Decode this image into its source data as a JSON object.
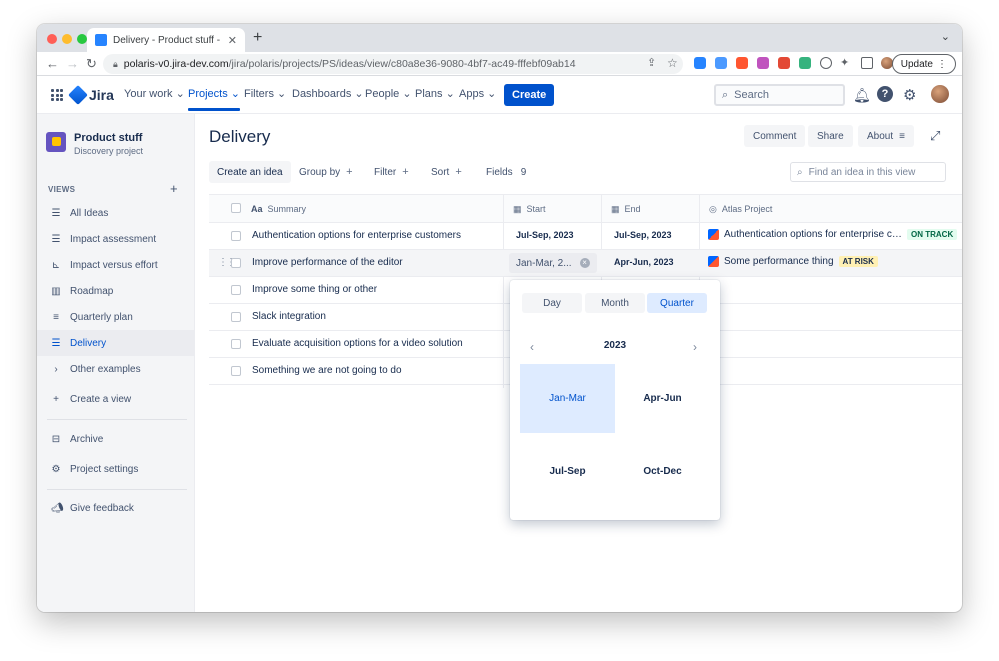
{
  "browser": {
    "tab_title": "Delivery - Product stuff - Jira Software",
    "url_host": "polaris-v0.jira-dev.com",
    "url_path": "/jira/polaris/projects/PS/ideas/view/c80a8e36-9080-4bf7-ac49-fffebf09ab14",
    "update_label": "Update"
  },
  "topnav": {
    "logo": "Jira",
    "items": [
      "Your work",
      "Projects",
      "Filters",
      "Dashboards",
      "People",
      "Plans",
      "Apps"
    ],
    "create_label": "Create",
    "search_placeholder": "Search"
  },
  "sidebar": {
    "project_name": "Product stuff",
    "project_type": "Discovery project",
    "views_header": "VIEWS",
    "views": [
      {
        "label": "All Ideas",
        "icon": "list-icon"
      },
      {
        "label": "Impact assessment",
        "icon": "list-icon"
      },
      {
        "label": "Impact versus effort",
        "icon": "matrix-icon"
      },
      {
        "label": "Roadmap",
        "icon": "board-icon"
      },
      {
        "label": "Quarterly plan",
        "icon": "timeline-icon"
      },
      {
        "label": "Delivery",
        "icon": "list-icon",
        "active": true
      },
      {
        "label": "Other examples",
        "icon": "chevron-right-icon"
      }
    ],
    "create_view": "Create a view",
    "archive": "Archive",
    "settings": "Project settings",
    "feedback": "Give feedback"
  },
  "main": {
    "title": "Delivery",
    "comment_label": "Comment",
    "share_label": "Share",
    "about_label": "About",
    "toolbar": {
      "create_idea": "Create an idea",
      "group_by": "Group by",
      "filter": "Filter",
      "sort": "Sort",
      "fields": "Fields",
      "fields_count": "9",
      "find_placeholder": "Find an idea in this view"
    },
    "columns": {
      "summary": "Summary",
      "summary_prefix": "Aa",
      "start": "Start",
      "end": "End",
      "atlas": "Atlas Project"
    },
    "rows": [
      {
        "summary": "Authentication options for enterprise customers",
        "start": "Jul-Sep, 2023",
        "end": "Jul-Sep, 2023",
        "atlas": "Authentication options for enterprise customers",
        "status": "ON TRACK"
      },
      {
        "summary": "Improve performance of the editor",
        "start": "Jan-Mar, 2...",
        "end": "Apr-Jun, 2023",
        "atlas": "Some performance thing",
        "status": "AT RISK"
      },
      {
        "summary": "Improve some thing or other"
      },
      {
        "summary": "Slack integration"
      },
      {
        "summary": "Evaluate acquisition options for a video solution"
      },
      {
        "summary": "Something we are not going to do"
      }
    ]
  },
  "picker": {
    "modes": [
      "Day",
      "Month",
      "Quarter"
    ],
    "active_mode": "Quarter",
    "year": "2023",
    "quarters": [
      "Jan-Mar",
      "Apr-Jun",
      "Jul-Sep",
      "Oct-Dec"
    ],
    "selected": "Jan-Mar"
  },
  "colors": {
    "primary": "#0052cc",
    "selected_bg": "#deebff",
    "on_track_bg": "#e3fcef",
    "at_risk_bg": "#fff0b3"
  }
}
